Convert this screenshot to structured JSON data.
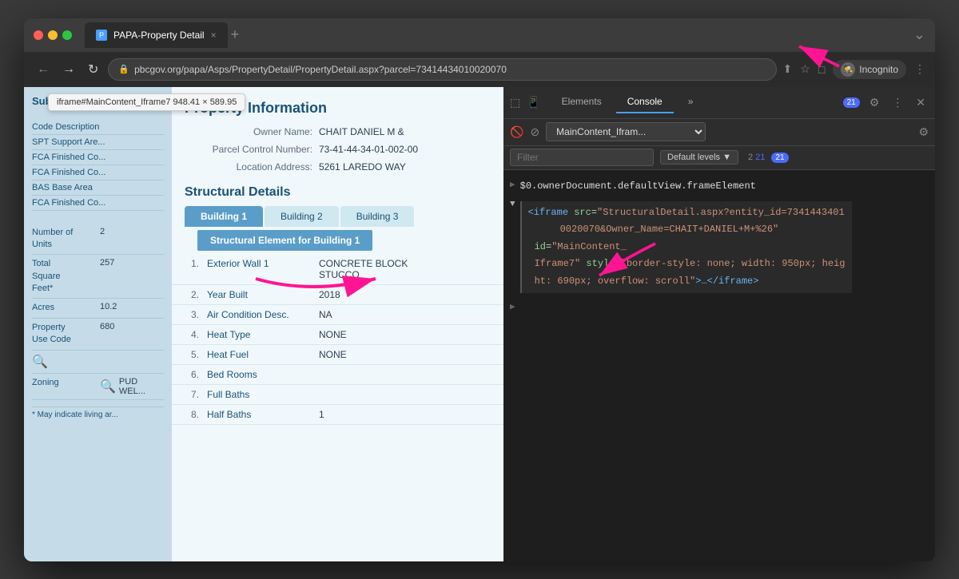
{
  "browser": {
    "title": "PAPA-Property Detail",
    "url": "pbcgov.org/papa/Asps/PropertyDetail/PropertyDetail.aspx?parcel=73414434010020070",
    "tab_close": "×",
    "tab_new": "+",
    "incognito_label": "Incognito"
  },
  "devtools": {
    "tabs": [
      "Elements",
      "Console",
      "»"
    ],
    "active_tab": "Console",
    "console_select": "MainContent_Ifram...",
    "filter_placeholder": "Filter",
    "levels_label": "Default levels ▼",
    "badge_count": "21",
    "errors_count": "21",
    "line1_text": "$0.ownerDocument.defaultView.frameElement",
    "iframe_code": "<iframe src=\"StructuralDetail.aspx?entity_id=734144340\n1002007 0&Owner_Name=CHAIT+DANIEL+M+%26\" id=\"MainContent_\nIframe7\" style=\"border-style: none; width: 950px; heig\nht: 690px; overflow: scroll\">…</iframe>",
    "tooltip": "iframe#MainContent_Iframe7  948.41 × 589.95"
  },
  "webpage": {
    "sidebar_title": "Subarea an...",
    "sidebar_items": [
      "Code Description",
      "SPT Support Are...",
      "FCA Finished Co...",
      "FCA Finished Co...",
      "BAS Base Area",
      "FCA Finished Co..."
    ],
    "data_rows": [
      {
        "label": "Number of\nUnits",
        "value": "2"
      },
      {
        "label": "Total\nSquare\nFeet*",
        "value": "257"
      },
      {
        "label": "Acres",
        "value": "10.2"
      },
      {
        "label": "Property\nUse Code",
        "value": "680"
      },
      {
        "label": "Zoning",
        "value": "PUD\nWEL..."
      }
    ],
    "property_info": {
      "title": "Property Information",
      "owner_label": "Owner Name:",
      "owner_value": "CHAIT DANIEL M &",
      "parcel_label": "Parcel Control Number:",
      "parcel_value": "73-41-44-34-01-002-00",
      "address_label": "Location Address:",
      "address_value": "5261 LAREDO WAY"
    },
    "structural": {
      "title": "Structural Details",
      "tabs": [
        "Building 1",
        "Building 2",
        "Building 3"
      ],
      "active_tab": "Building 1",
      "element_header": "Structural Element for Building  1",
      "rows": [
        {
          "num": "1.",
          "label": "Exterior Wall 1",
          "value": "CONCRETE BLOCK\nSTUCCO"
        },
        {
          "num": "2.",
          "label": "Year Built",
          "value": "2018"
        },
        {
          "num": "3.",
          "label": "Air Condition Desc.",
          "value": "NA"
        },
        {
          "num": "4.",
          "label": "Heat Type",
          "value": "NONE"
        },
        {
          "num": "5.",
          "label": "Heat Fuel",
          "value": "NONE"
        },
        {
          "num": "6.",
          "label": "Bed Rooms",
          "value": ""
        },
        {
          "num": "7.",
          "label": "Full Baths",
          "value": ""
        },
        {
          "num": "8.",
          "label": "Half Baths",
          "value": "1"
        }
      ]
    },
    "footer_note": "* May indicate living ar..."
  }
}
